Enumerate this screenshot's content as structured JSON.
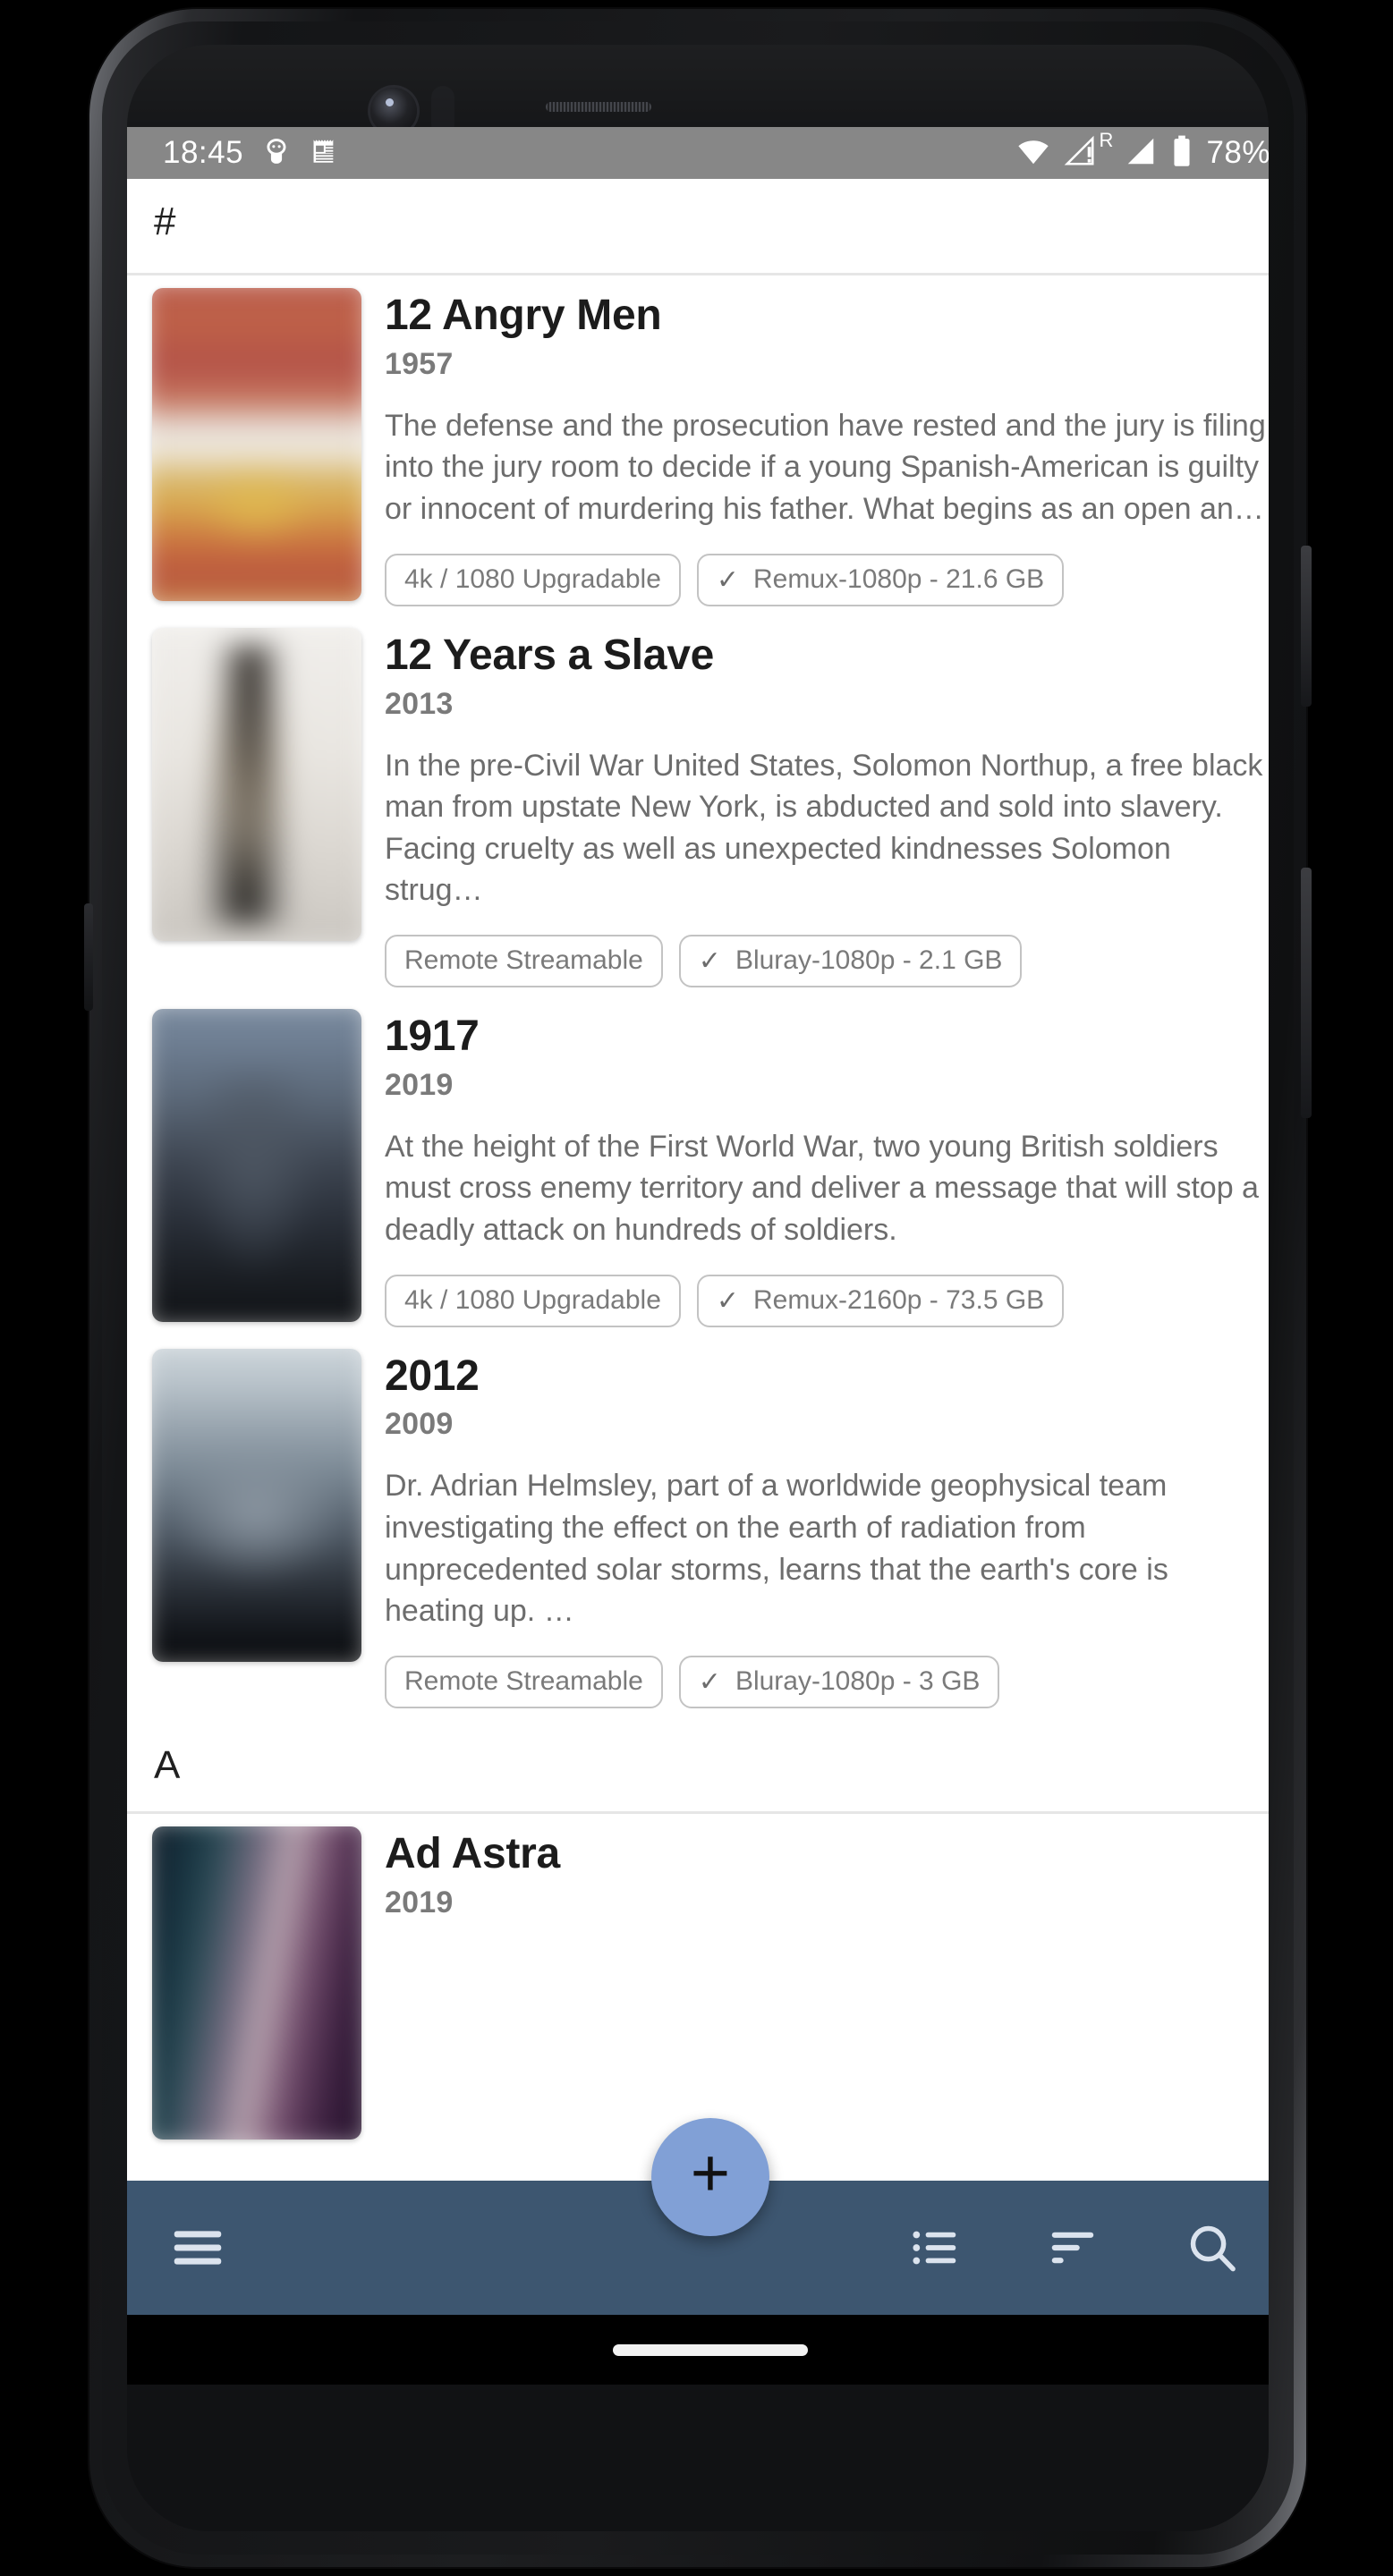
{
  "status_bar": {
    "time": "18:45",
    "battery_percent": "78%",
    "icons": [
      "android-debug-icon",
      "calendar-icon",
      "wifi-icon",
      "cellular-alert-icon",
      "roaming-r-label",
      "cellular-signal-icon",
      "battery-icon"
    ],
    "roaming_label": "R",
    "background": "#878787"
  },
  "sections": [
    {
      "letter": "#",
      "items": [
        {
          "title": "12 Angry Men",
          "year": "1957",
          "overview": "The defense and the prosecution have rested and the jury is filing into the jury room to decide if a young Spanish-American is guilty or innocent of murdering his father. What begins as an open an…",
          "chips": [
            {
              "label": "4k / 1080 Upgradable",
              "checked": false
            },
            {
              "label": "Remux-1080p - 21.6 GB",
              "checked": true
            }
          ]
        },
        {
          "title": "12 Years a Slave",
          "year": "2013",
          "overview": "In the pre-Civil War United States, Solomon Northup, a free black man from upstate New York, is abducted and sold into slavery. Facing cruelty as well as unexpected kindnesses Solomon strug…",
          "chips": [
            {
              "label": "Remote Streamable",
              "checked": false
            },
            {
              "label": "Bluray-1080p - 2.1 GB",
              "checked": true
            }
          ]
        },
        {
          "title": "1917",
          "year": "2019",
          "overview": "At the height of the First World War, two young British soldiers must cross enemy territory and deliver a message that will stop a deadly attack on hundreds of soldiers.",
          "chips": [
            {
              "label": "4k / 1080 Upgradable",
              "checked": false
            },
            {
              "label": "Remux-2160p - 73.5 GB",
              "checked": true
            }
          ]
        },
        {
          "title": "2012",
          "year": "2009",
          "overview": "Dr. Adrian Helmsley, part of a worldwide geophysical team investigating the effect on the earth of radiation from unprecedented solar storms, learns that the earth's core is heating up. …",
          "chips": [
            {
              "label": "Remote Streamable",
              "checked": false
            },
            {
              "label": "Bluray-1080p - 3 GB",
              "checked": true
            }
          ]
        }
      ]
    },
    {
      "letter": "A",
      "items": [
        {
          "title": "Ad Astra",
          "year": "2019",
          "overview": "",
          "chips": []
        }
      ]
    }
  ],
  "chip_check_glyph": "✓",
  "bottom_bar": {
    "background": "#3d5670",
    "menu_icon": "hamburger-menu-icon",
    "list_icon": "list-view-icon",
    "sort_icon": "sort-filter-icon",
    "search_icon": "search-icon"
  },
  "fab": {
    "label": "+",
    "icon": "plus-icon",
    "background": "#81a0d6"
  },
  "theme": {
    "accent": "#81a0d6",
    "app_bar": "#3d5670",
    "surface": "#ffffff",
    "title_color": "#1c1c1c",
    "secondary_text": "#7a7a7a",
    "chip_border": "#c3c3c3"
  }
}
